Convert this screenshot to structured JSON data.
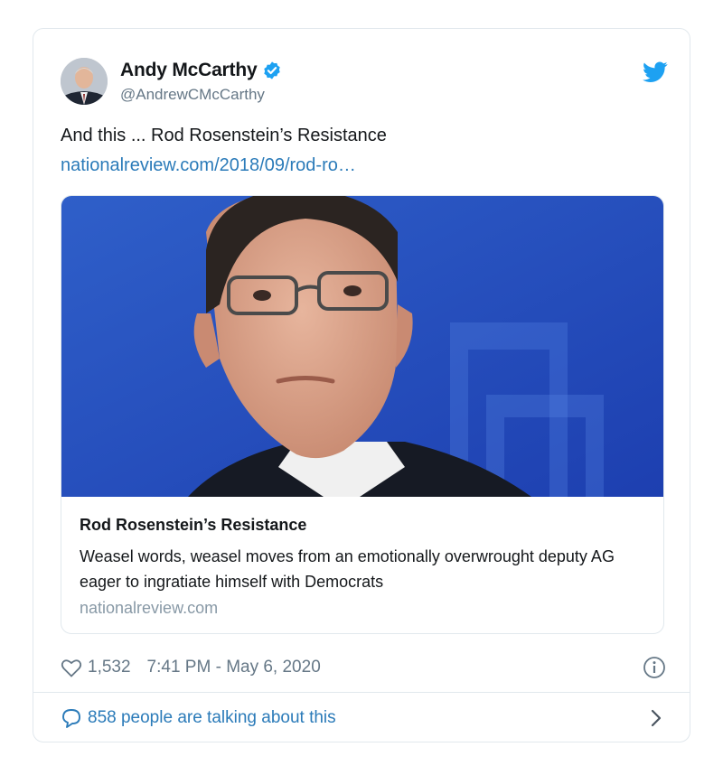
{
  "author": {
    "display_name": "Andy McCarthy",
    "handle": "@AndrewCMcCarthy",
    "verified": true
  },
  "tweet": {
    "text": "And this ... Rod Rosenstein’s Resistance",
    "link_text": "nationalreview.com/2018/09/rod-ro…"
  },
  "link_card": {
    "title": "Rod Rosenstein’s Resistance",
    "description": "Weasel words, weasel moves from an emotionally overwrought deputy AG eager to ingratiate himself with Democrats",
    "domain": "nationalreview.com"
  },
  "stats": {
    "likes": "1,532",
    "timestamp": "7:41 PM - May 6, 2020"
  },
  "conversation": {
    "text": "858 people are talking about this"
  },
  "colors": {
    "link_blue": "#2b7bb9",
    "twitter_blue": "#1da1f2",
    "muted_text": "#657786",
    "border": "#e1e8ed"
  },
  "icons": [
    "verified-badge-icon",
    "twitter-bird-icon",
    "heart-icon",
    "info-icon",
    "speech-bubble-icon",
    "chevron-right-icon"
  ]
}
